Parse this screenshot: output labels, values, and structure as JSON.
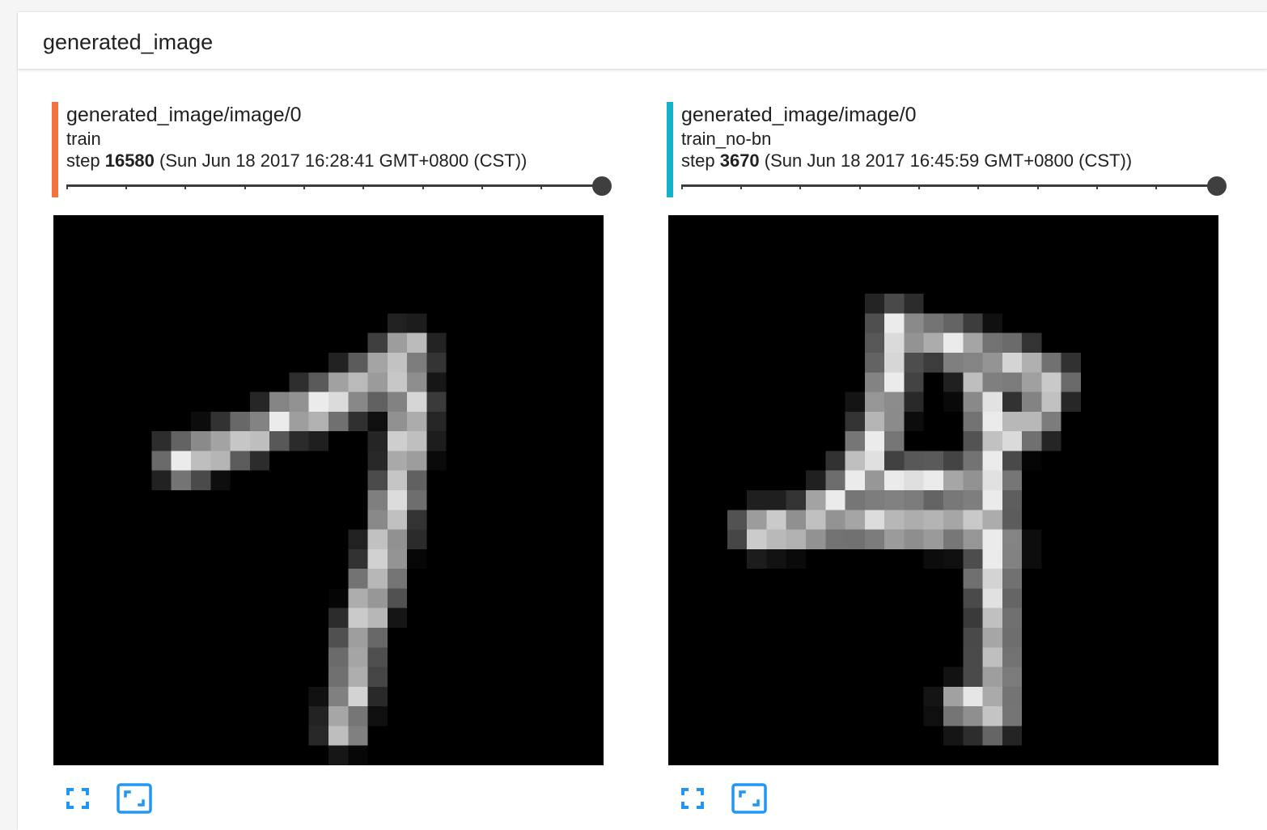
{
  "section": {
    "title": "generated_image"
  },
  "accent": {
    "button": "#2196f3",
    "slider": "#3c3c3c"
  },
  "cards": [
    {
      "tag": "generated_image/image/0",
      "run": "train",
      "run_color": "#f4723f",
      "step_label": "step",
      "step": "16580",
      "timestamp": "(Sun Jun 18 2017 16:28:41 GMT+0800 (CST))",
      "slider_position": 1.0,
      "image_label": "generated digit (handwritten 7)",
      "actions": [
        {
          "icon": "fullscreen-icon"
        },
        {
          "icon": "fit-to-screen-icon"
        }
      ]
    },
    {
      "tag": "generated_image/image/0",
      "run": "train_no-bn",
      "run_color": "#17b0c9",
      "step_label": "step",
      "step": "3670",
      "timestamp": "(Sun Jun 18 2017 16:45:59 GMT+0800 (CST))",
      "slider_position": 1.0,
      "image_label": "generated digit (handwritten 4/9)",
      "actions": [
        {
          "icon": "fullscreen-icon"
        },
        {
          "icon": "fit-to-screen-icon"
        }
      ]
    }
  ]
}
